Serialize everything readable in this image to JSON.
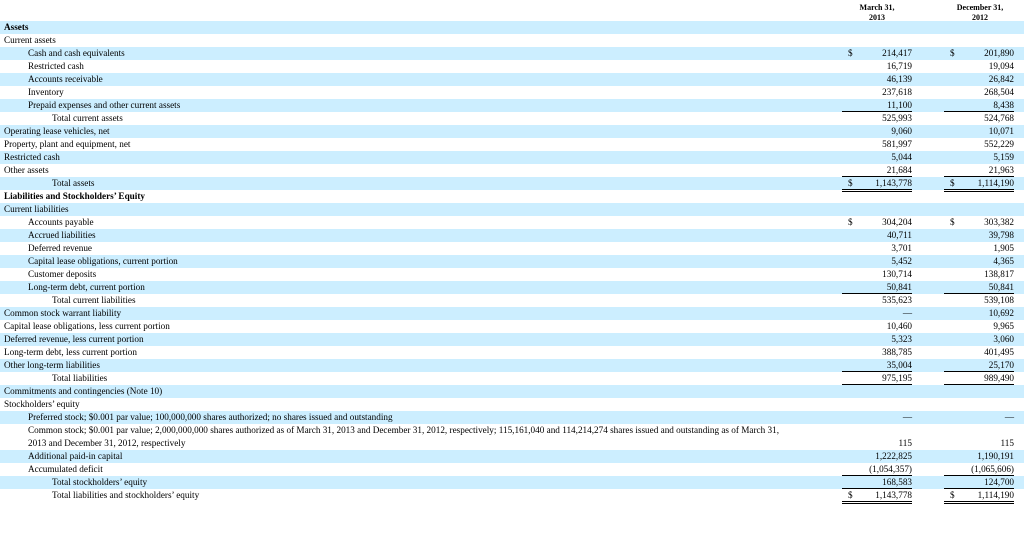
{
  "header": {
    "col1": [
      "March 31,",
      "2013"
    ],
    "col2": [
      "December 31,",
      "2012"
    ]
  },
  "rows": [
    {
      "label": "Assets",
      "bold": true,
      "indent": 0
    },
    {
      "label": "Current assets",
      "indent": 0
    },
    {
      "label": "Cash and cash equivalents",
      "indent": 1,
      "d1": "$",
      "v1": "214,417",
      "d2": "$",
      "v2": "201,890"
    },
    {
      "label": "Restricted cash",
      "indent": 1,
      "v1": "16,719",
      "v2": "19,094"
    },
    {
      "label": "Accounts receivable",
      "indent": 1,
      "v1": "46,139",
      "v2": "26,842"
    },
    {
      "label": "Inventory",
      "indent": 1,
      "v1": "237,618",
      "v2": "268,504"
    },
    {
      "label": "Prepaid expenses and other current assets",
      "indent": 1,
      "v1": "11,100",
      "v2": "8,438",
      "ul": 1
    },
    {
      "label": "Total current assets",
      "indent": 2,
      "v1": "525,993",
      "v2": "524,768"
    },
    {
      "label": "Operating lease vehicles, net",
      "indent": 0,
      "v1": "9,060",
      "v2": "10,071"
    },
    {
      "label": "Property, plant and equipment, net",
      "indent": 0,
      "v1": "581,997",
      "v2": "552,229"
    },
    {
      "label": "Restricted cash",
      "indent": 0,
      "v1": "5,044",
      "v2": "5,159"
    },
    {
      "label": "Other assets",
      "indent": 0,
      "v1": "21,684",
      "v2": "21,963",
      "ul": 1
    },
    {
      "label": "Total assets",
      "indent": 2,
      "d1": "$",
      "v1": "1,143,778",
      "d2": "$",
      "v2": "1,114,190",
      "ul": 2
    },
    {
      "label": "Liabilities and Stockholders’ Equity",
      "bold": true,
      "indent": 0
    },
    {
      "label": "Current liabilities",
      "indent": 0
    },
    {
      "label": "Accounts payable",
      "indent": 1,
      "d1": "$",
      "v1": "304,204",
      "d2": "$",
      "v2": "303,382"
    },
    {
      "label": "Accrued liabilities",
      "indent": 1,
      "v1": "40,711",
      "v2": "39,798"
    },
    {
      "label": "Deferred revenue",
      "indent": 1,
      "v1": "3,701",
      "v2": "1,905"
    },
    {
      "label": "Capital lease obligations, current portion",
      "indent": 1,
      "v1": "5,452",
      "v2": "4,365"
    },
    {
      "label": "Customer deposits",
      "indent": 1,
      "v1": "130,714",
      "v2": "138,817"
    },
    {
      "label": "Long-term debt, current portion",
      "indent": 1,
      "v1": "50,841",
      "v2": "50,841",
      "ul": 1
    },
    {
      "label": "Total current liabilities",
      "indent": 2,
      "v1": "535,623",
      "v2": "539,108"
    },
    {
      "label": "Common stock warrant liability",
      "indent": 0,
      "v1": "—",
      "v2": "10,692"
    },
    {
      "label": "Capital lease obligations, less current portion",
      "indent": 0,
      "v1": "10,460",
      "v2": "9,965"
    },
    {
      "label": "Deferred revenue, less current portion",
      "indent": 0,
      "v1": "5,323",
      "v2": "3,060"
    },
    {
      "label": "Long-term debt, less current portion",
      "indent": 0,
      "v1": "388,785",
      "v2": "401,495"
    },
    {
      "label": "Other long-term liabilities",
      "indent": 0,
      "v1": "35,004",
      "v2": "25,170",
      "ul": 1
    },
    {
      "label": "Total liabilities",
      "indent": 2,
      "v1": "975,195",
      "v2": "989,490",
      "ul": 1
    },
    {
      "label": "Commitments and contingencies (Note 10)",
      "indent": 0
    },
    {
      "label": "Stockholders’ equity",
      "indent": 0
    },
    {
      "label": "Preferred stock; $0.001 par value; 100,000,000 shares authorized; no shares issued and outstanding",
      "indent": 1,
      "v1": "—",
      "v2": "—"
    },
    {
      "label": "Common stock; $0.001 par value; 2,000,000,000 shares authorized as of March 31, 2013 and December 31, 2012, respectively; 115,161,040 and 114,214,274 shares issued and outstanding as of March 31, 2013 and December 31, 2012, respectively",
      "indent": 1,
      "v1": "115",
      "v2": "115",
      "tall": true
    },
    {
      "label": "Additional paid-in capital",
      "indent": 1,
      "v1": "1,222,825",
      "v2": "1,190,191"
    },
    {
      "label": "Accumulated deficit",
      "indent": 1,
      "v1": "(1,054,357)",
      "v2": "(1,065,606)",
      "ul": 1
    },
    {
      "label": "Total stockholders’ equity",
      "indent": 2,
      "v1": "168,583",
      "v2": "124,700",
      "ul": 1
    },
    {
      "label": "Total liabilities and stockholders’ equity",
      "indent": 2,
      "d1": "$",
      "v1": "1,143,778",
      "d2": "$",
      "v2": "1,114,190",
      "ul": 2
    }
  ]
}
